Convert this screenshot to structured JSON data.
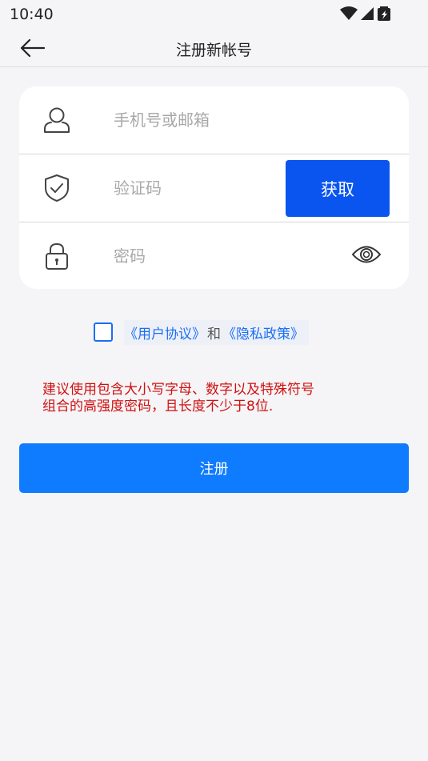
{
  "status_bar": {
    "time": "10:40",
    "icons": [
      "wifi-icon",
      "signal-icon",
      "battery-icon"
    ]
  },
  "nav": {
    "title": "注册新帐号",
    "back_icon": "arrow-left-icon"
  },
  "form": {
    "account": {
      "placeholder": "手机号或邮箱",
      "icon": "user-icon"
    },
    "code": {
      "placeholder": "验证码",
      "icon": "shield-check-icon",
      "button_label": "获取"
    },
    "password": {
      "placeholder": "密码",
      "icon": "lock-icon",
      "toggle_icon": "eye-icon"
    }
  },
  "agreement": {
    "checked": false,
    "user_agreement": "《用户协议》",
    "and": "和",
    "privacy_policy": "《隐私政策》"
  },
  "hint": {
    "line1": "建议使用包含大小写字母、数字以及特殊符号",
    "line2": "组合的高强度密码，且长度不少于8位."
  },
  "register_button": {
    "label": "注册"
  },
  "colors": {
    "primary": "#0f7bff",
    "code_button": "#0a55f0",
    "link": "#1a6ff5",
    "warning": "#d01010",
    "background": "#f5f5f7"
  }
}
